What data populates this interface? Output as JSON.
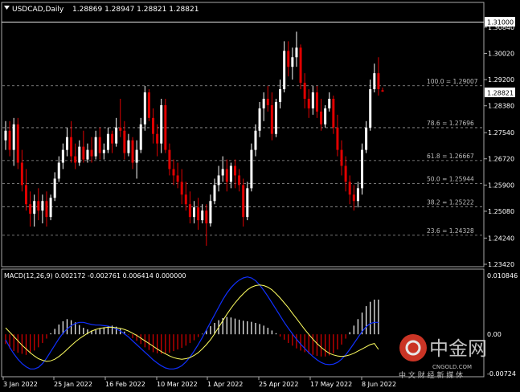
{
  "window": {
    "title": "USDCAD,Daily",
    "ohlc_readout": "1.28869 1.28947 1.28821 1.28821",
    "triangle_icon": "dropdown-triangle-icon"
  },
  "colors": {
    "background": "#000000",
    "grid": "#a9a9a9",
    "axis_text": "#ffffff",
    "bull": "#ffffff",
    "bear": "#e00000",
    "hist_pos": "#ffffff",
    "hist_neg": "#e00000",
    "macd_line": "#1030ff",
    "signal_line": "#ffff60",
    "fib_line": "#9a9a9a",
    "fib_text": "#bfbfbf",
    "current_price_box": "#ffffff",
    "watermark_red": "#e03a2a"
  },
  "price_axis": {
    "labels": [
      "1.30840",
      "1.30020",
      "1.29200",
      "1.28380",
      "1.27540",
      "1.26720",
      "1.25900",
      "1.25080",
      "1.24240",
      "1.23420"
    ],
    "highlight_top": "1.31000",
    "current_price": "1.28821"
  },
  "fibonacci": [
    {
      "label": "100.0 = 1.29007",
      "price": 1.29007
    },
    {
      "label": "78.6 = 1.27696",
      "price": 1.27696
    },
    {
      "label": "61.8 = 1.26667",
      "price": 1.26667
    },
    {
      "label": "50.0 = 1.25944",
      "price": 1.25944
    },
    {
      "label": "38.2 = 1.25222",
      "price": 1.25222
    },
    {
      "label": "23.6 = 1.24328",
      "price": 1.24328
    }
  ],
  "macd_panel": {
    "title": "MACD(12,26,9) 0.002172 -0.002761 0.006414 0.000000",
    "axis_labels": {
      "top": "0.010846",
      "zero": "0.00",
      "bottom": "-0.00724"
    }
  },
  "time_axis": [
    "3 Jan 2022",
    "25 Jan 2022",
    "16 Feb 2022",
    "10 Mar 2022",
    "1 Apr 2022",
    "25 Apr 2022",
    "17 May 2022",
    "8 Jun 2022"
  ],
  "watermark": {
    "brand": "中金网",
    "domain": "CNGOLD.COM",
    "slogan": "中 文 财 经 新 媒 体"
  },
  "chart_data": {
    "type": "candlestick",
    "symbol": "USDCAD",
    "timeframe": "Daily",
    "ylim": [
      1.2342,
      1.31
    ],
    "last": {
      "open": 1.28869,
      "high": 1.28947,
      "low": 1.28821,
      "close": 1.28821
    },
    "macd": {
      "main": 0.002172,
      "signal": -0.002761,
      "histogram": 0.006414,
      "extra": 0.0
    },
    "macd_ylim": [
      -0.00724,
      0.010846
    ],
    "x_ticks": [
      "3 Jan 2022",
      "25 Jan 2022",
      "16 Feb 2022",
      "10 Mar 2022",
      "1 Apr 2022",
      "25 Apr 2022",
      "17 May 2022",
      "8 Jun 2022"
    ],
    "candles": [
      {
        "o": 1.273,
        "h": 1.279,
        "l": 1.27,
        "c": 1.276
      },
      {
        "o": 1.276,
        "h": 1.279,
        "l": 1.268,
        "c": 1.27
      },
      {
        "o": 1.27,
        "h": 1.28,
        "l": 1.265,
        "c": 1.278
      },
      {
        "o": 1.278,
        "h": 1.28,
        "l": 1.264,
        "c": 1.266
      },
      {
        "o": 1.266,
        "h": 1.27,
        "l": 1.257,
        "c": 1.259
      },
      {
        "o": 1.259,
        "h": 1.264,
        "l": 1.251,
        "c": 1.253
      },
      {
        "o": 1.253,
        "h": 1.257,
        "l": 1.246,
        "c": 1.25
      },
      {
        "o": 1.25,
        "h": 1.256,
        "l": 1.246,
        "c": 1.254
      },
      {
        "o": 1.254,
        "h": 1.258,
        "l": 1.248,
        "c": 1.251
      },
      {
        "o": 1.251,
        "h": 1.256,
        "l": 1.247,
        "c": 1.254
      },
      {
        "o": 1.254,
        "h": 1.257,
        "l": 1.246,
        "c": 1.249
      },
      {
        "o": 1.249,
        "h": 1.256,
        "l": 1.248,
        "c": 1.255
      },
      {
        "o": 1.255,
        "h": 1.263,
        "l": 1.254,
        "c": 1.261
      },
      {
        "o": 1.261,
        "h": 1.268,
        "l": 1.26,
        "c": 1.266
      },
      {
        "o": 1.266,
        "h": 1.272,
        "l": 1.264,
        "c": 1.27
      },
      {
        "o": 1.27,
        "h": 1.277,
        "l": 1.268,
        "c": 1.274
      },
      {
        "o": 1.274,
        "h": 1.279,
        "l": 1.266,
        "c": 1.268
      },
      {
        "o": 1.268,
        "h": 1.272,
        "l": 1.264,
        "c": 1.266
      },
      {
        "o": 1.266,
        "h": 1.273,
        "l": 1.265,
        "c": 1.271
      },
      {
        "o": 1.271,
        "h": 1.276,
        "l": 1.266,
        "c": 1.267
      },
      {
        "o": 1.267,
        "h": 1.272,
        "l": 1.266,
        "c": 1.27
      },
      {
        "o": 1.27,
        "h": 1.274,
        "l": 1.266,
        "c": 1.268
      },
      {
        "o": 1.268,
        "h": 1.276,
        "l": 1.267,
        "c": 1.274
      },
      {
        "o": 1.274,
        "h": 1.277,
        "l": 1.267,
        "c": 1.269
      },
      {
        "o": 1.269,
        "h": 1.272,
        "l": 1.267,
        "c": 1.27
      },
      {
        "o": 1.27,
        "h": 1.277,
        "l": 1.269,
        "c": 1.275
      },
      {
        "o": 1.275,
        "h": 1.276,
        "l": 1.269,
        "c": 1.272
      },
      {
        "o": 1.272,
        "h": 1.28,
        "l": 1.271,
        "c": 1.277
      },
      {
        "o": 1.277,
        "h": 1.286,
        "l": 1.274,
        "c": 1.276
      },
      {
        "o": 1.276,
        "h": 1.279,
        "l": 1.267,
        "c": 1.269
      },
      {
        "o": 1.269,
        "h": 1.275,
        "l": 1.268,
        "c": 1.273
      },
      {
        "o": 1.273,
        "h": 1.274,
        "l": 1.264,
        "c": 1.266
      },
      {
        "o": 1.266,
        "h": 1.273,
        "l": 1.261,
        "c": 1.27
      },
      {
        "o": 1.27,
        "h": 1.28,
        "l": 1.269,
        "c": 1.278
      },
      {
        "o": 1.278,
        "h": 1.29,
        "l": 1.276,
        "c": 1.288
      },
      {
        "o": 1.288,
        "h": 1.289,
        "l": 1.279,
        "c": 1.28
      },
      {
        "o": 1.28,
        "h": 1.283,
        "l": 1.272,
        "c": 1.275
      },
      {
        "o": 1.275,
        "h": 1.278,
        "l": 1.268,
        "c": 1.272
      },
      {
        "o": 1.272,
        "h": 1.286,
        "l": 1.269,
        "c": 1.284
      },
      {
        "o": 1.284,
        "h": 1.286,
        "l": 1.269,
        "c": 1.27
      },
      {
        "o": 1.27,
        "h": 1.272,
        "l": 1.262,
        "c": 1.264
      },
      {
        "o": 1.264,
        "h": 1.267,
        "l": 1.259,
        "c": 1.262
      },
      {
        "o": 1.262,
        "h": 1.266,
        "l": 1.258,
        "c": 1.26
      },
      {
        "o": 1.26,
        "h": 1.264,
        "l": 1.253,
        "c": 1.256
      },
      {
        "o": 1.256,
        "h": 1.26,
        "l": 1.251,
        "c": 1.253
      },
      {
        "o": 1.253,
        "h": 1.257,
        "l": 1.247,
        "c": 1.249
      },
      {
        "o": 1.249,
        "h": 1.254,
        "l": 1.247,
        "c": 1.252
      },
      {
        "o": 1.252,
        "h": 1.255,
        "l": 1.245,
        "c": 1.248
      },
      {
        "o": 1.248,
        "h": 1.253,
        "l": 1.247,
        "c": 1.251
      },
      {
        "o": 1.251,
        "h": 1.253,
        "l": 1.24,
        "c": 1.247
      },
      {
        "o": 1.247,
        "h": 1.256,
        "l": 1.246,
        "c": 1.254
      },
      {
        "o": 1.254,
        "h": 1.261,
        "l": 1.253,
        "c": 1.259
      },
      {
        "o": 1.259,
        "h": 1.265,
        "l": 1.257,
        "c": 1.262
      },
      {
        "o": 1.262,
        "h": 1.268,
        "l": 1.26,
        "c": 1.264
      },
      {
        "o": 1.264,
        "h": 1.267,
        "l": 1.257,
        "c": 1.26
      },
      {
        "o": 1.26,
        "h": 1.266,
        "l": 1.258,
        "c": 1.265
      },
      {
        "o": 1.265,
        "h": 1.267,
        "l": 1.258,
        "c": 1.262
      },
      {
        "o": 1.262,
        "h": 1.264,
        "l": 1.257,
        "c": 1.259
      },
      {
        "o": 1.259,
        "h": 1.261,
        "l": 1.246,
        "c": 1.249
      },
      {
        "o": 1.249,
        "h": 1.26,
        "l": 1.248,
        "c": 1.258
      },
      {
        "o": 1.258,
        "h": 1.272,
        "l": 1.257,
        "c": 1.27
      },
      {
        "o": 1.27,
        "h": 1.278,
        "l": 1.268,
        "c": 1.276
      },
      {
        "o": 1.276,
        "h": 1.285,
        "l": 1.274,
        "c": 1.283
      },
      {
        "o": 1.283,
        "h": 1.288,
        "l": 1.279,
        "c": 1.286
      },
      {
        "o": 1.286,
        "h": 1.29,
        "l": 1.282,
        "c": 1.284
      },
      {
        "o": 1.284,
        "h": 1.288,
        "l": 1.273,
        "c": 1.275
      },
      {
        "o": 1.275,
        "h": 1.286,
        "l": 1.274,
        "c": 1.285
      },
      {
        "o": 1.285,
        "h": 1.292,
        "l": 1.283,
        "c": 1.289
      },
      {
        "o": 1.289,
        "h": 1.304,
        "l": 1.288,
        "c": 1.301
      },
      {
        "o": 1.301,
        "h": 1.304,
        "l": 1.293,
        "c": 1.296
      },
      {
        "o": 1.296,
        "h": 1.302,
        "l": 1.292,
        "c": 1.299
      },
      {
        "o": 1.299,
        "h": 1.307,
        "l": 1.296,
        "c": 1.302
      },
      {
        "o": 1.302,
        "h": 1.303,
        "l": 1.289,
        "c": 1.291
      },
      {
        "o": 1.291,
        "h": 1.294,
        "l": 1.283,
        "c": 1.286
      },
      {
        "o": 1.286,
        "h": 1.289,
        "l": 1.28,
        "c": 1.283
      },
      {
        "o": 1.283,
        "h": 1.29,
        "l": 1.281,
        "c": 1.288
      },
      {
        "o": 1.288,
        "h": 1.29,
        "l": 1.28,
        "c": 1.282
      },
      {
        "o": 1.282,
        "h": 1.286,
        "l": 1.276,
        "c": 1.278
      },
      {
        "o": 1.278,
        "h": 1.284,
        "l": 1.277,
        "c": 1.283
      },
      {
        "o": 1.283,
        "h": 1.288,
        "l": 1.282,
        "c": 1.286
      },
      {
        "o": 1.286,
        "h": 1.287,
        "l": 1.275,
        "c": 1.277
      },
      {
        "o": 1.277,
        "h": 1.281,
        "l": 1.268,
        "c": 1.27
      },
      {
        "o": 1.27,
        "h": 1.273,
        "l": 1.262,
        "c": 1.265
      },
      {
        "o": 1.265,
        "h": 1.268,
        "l": 1.257,
        "c": 1.26
      },
      {
        "o": 1.26,
        "h": 1.262,
        "l": 1.253,
        "c": 1.256
      },
      {
        "o": 1.256,
        "h": 1.259,
        "l": 1.251,
        "c": 1.254
      },
      {
        "o": 1.254,
        "h": 1.26,
        "l": 1.252,
        "c": 1.258
      },
      {
        "o": 1.258,
        "h": 1.272,
        "l": 1.256,
        "c": 1.27
      },
      {
        "o": 1.27,
        "h": 1.279,
        "l": 1.269,
        "c": 1.277
      },
      {
        "o": 1.277,
        "h": 1.292,
        "l": 1.276,
        "c": 1.289
      },
      {
        "o": 1.289,
        "h": 1.297,
        "l": 1.288,
        "c": 1.294
      },
      {
        "o": 1.294,
        "h": 1.299,
        "l": 1.287,
        "c": 1.289
      },
      {
        "o": 1.28869,
        "h": 1.28947,
        "l": 1.28821,
        "c": 1.28821
      }
    ],
    "macd_histogram": [
      -0.0018,
      -0.0026,
      -0.0031,
      -0.0034,
      -0.0036,
      -0.0038,
      -0.0035,
      -0.003,
      -0.0024,
      -0.0016,
      -0.0008,
      0.0002,
      0.001,
      0.0018,
      0.0024,
      0.0028,
      0.0026,
      0.0022,
      0.0017,
      0.0012,
      0.0009,
      0.0007,
      0.0008,
      0.0011,
      0.0013,
      0.0015,
      0.0016,
      0.0014,
      0.001,
      0.0005,
      -0.0001,
      -0.0007,
      -0.0012,
      -0.0018,
      -0.0024,
      -0.0029,
      -0.0033,
      -0.0035,
      -0.0036,
      -0.0036,
      -0.0034,
      -0.0031,
      -0.0028,
      -0.0025,
      -0.0021,
      -0.0016,
      -0.0011,
      -0.0005,
      0.0001,
      0.0008,
      0.0015,
      0.0021,
      0.0026,
      0.003,
      0.0032,
      0.0031,
      0.0029,
      0.0027,
      0.0025,
      0.0024,
      0.0023,
      0.0021,
      0.0019,
      0.0016,
      0.0012,
      0.0007,
      0.0002,
      -0.0004,
      -0.001,
      -0.0016,
      -0.0021,
      -0.0026,
      -0.003,
      -0.0033,
      -0.0036,
      -0.0038,
      -0.004,
      -0.0041,
      -0.0041,
      -0.0039,
      -0.0035,
      -0.0028,
      -0.0019,
      -0.0008,
      0.0004,
      0.0016,
      0.0028,
      0.004,
      0.0052,
      0.006,
      0.0064,
      0.0064
    ],
    "macd_main": [
      -0.001,
      -0.0024,
      -0.0036,
      -0.0046,
      -0.0054,
      -0.006,
      -0.0064,
      -0.0064,
      -0.0061,
      -0.0054,
      -0.0044,
      -0.0032,
      -0.002,
      -0.0008,
      0.0002,
      0.001,
      0.0016,
      0.002,
      0.0022,
      0.0022,
      0.002,
      0.0018,
      0.0017,
      0.0017,
      0.0016,
      0.0015,
      0.0013,
      0.001,
      0.0006,
      0.0001,
      -0.0005,
      -0.0012,
      -0.0019,
      -0.0026,
      -0.0033,
      -0.004,
      -0.0047,
      -0.0053,
      -0.0058,
      -0.0062,
      -0.0064,
      -0.0064,
      -0.0062,
      -0.0058,
      -0.0051,
      -0.0042,
      -0.0031,
      -0.0019,
      -0.0006,
      0.0008,
      0.0022,
      0.0036,
      0.005,
      0.0064,
      0.0076,
      0.0086,
      0.0094,
      0.01,
      0.0104,
      0.0106,
      0.0104,
      0.0099,
      0.0091,
      0.0081,
      0.007,
      0.0058,
      0.0046,
      0.0034,
      0.0022,
      0.0011,
      0.0001,
      -0.0009,
      -0.0018,
      -0.0026,
      -0.0034,
      -0.0041,
      -0.0047,
      -0.0052,
      -0.0055,
      -0.0056,
      -0.0055,
      -0.0052,
      -0.0046,
      -0.0038,
      -0.0028,
      -0.0017,
      -0.0006,
      0.0005,
      0.0014,
      0.002,
      0.0022,
      0.0022
    ],
    "macd_signal": [
      0.0012,
      0.0004,
      -0.0004,
      -0.0012,
      -0.002,
      -0.0027,
      -0.0034,
      -0.004,
      -0.0045,
      -0.0048,
      -0.005,
      -0.0049,
      -0.0046,
      -0.0041,
      -0.0035,
      -0.0028,
      -0.0021,
      -0.0014,
      -0.0008,
      -0.0003,
      0.0002,
      0.0006,
      0.0009,
      0.0011,
      0.0012,
      0.0013,
      0.0013,
      0.0012,
      0.0011,
      0.0009,
      0.0006,
      0.0002,
      -0.0002,
      -0.0007,
      -0.0012,
      -0.0017,
      -0.0022,
      -0.0027,
      -0.0032,
      -0.0036,
      -0.004,
      -0.0043,
      -0.0045,
      -0.0046,
      -0.0045,
      -0.0043,
      -0.0039,
      -0.0034,
      -0.0027,
      -0.0019,
      -0.001,
      0.0001,
      0.0013,
      0.0025,
      0.0037,
      0.0048,
      0.0058,
      0.0067,
      0.0075,
      0.0082,
      0.0087,
      0.009,
      0.0091,
      0.009,
      0.0087,
      0.0082,
      0.0075,
      0.0067,
      0.0058,
      0.0049,
      0.0039,
      0.0029,
      0.0019,
      0.0009,
      0.0,
      -0.0009,
      -0.0017,
      -0.0024,
      -0.003,
      -0.0035,
      -0.0038,
      -0.004,
      -0.0041,
      -0.004,
      -0.0038,
      -0.0035,
      -0.0031,
      -0.0027,
      -0.0023,
      -0.0019,
      -0.0017,
      -0.0028
    ]
  }
}
